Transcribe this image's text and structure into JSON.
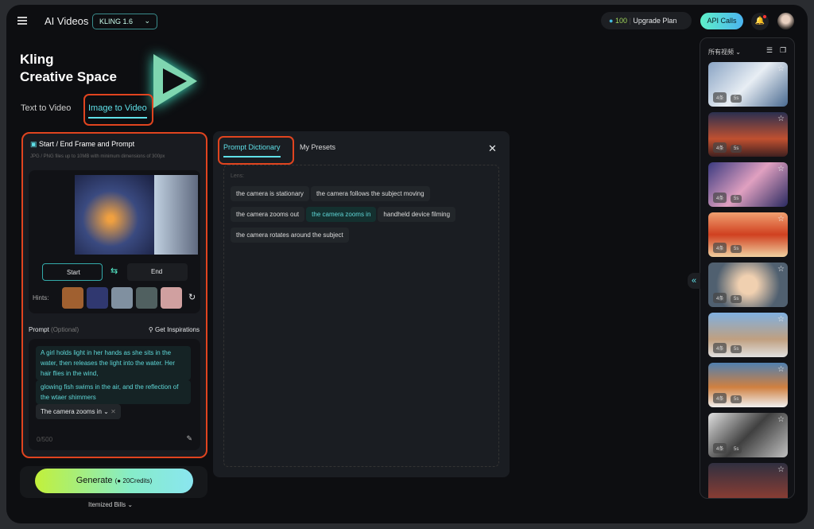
{
  "header": {
    "title": "AI Videos",
    "model": "KLING 1.6",
    "credits": "100",
    "upgrade": "Upgrade Plan",
    "api": "API Calls"
  },
  "hero": {
    "line1": "Kling",
    "line2": "Creative Space"
  },
  "tabs": [
    {
      "label": "Text to Video"
    },
    {
      "label": "Image to Video",
      "active": true
    }
  ],
  "frame": {
    "title": "Start / End Frame and Prompt",
    "hint": "JPG / PNG files up to 10MB with minimum dimensions of 300px",
    "start": "Start",
    "end": "End",
    "hints_label": "Hints:"
  },
  "prompt": {
    "label": "Prompt",
    "optional": "(Optional)",
    "inspire": "Get Inspirations",
    "seg1": "A girl holds light in her hands as she sits in the water, then releases the light into the water. Her hair flies in the wind,",
    "seg2": "glowing fish swims in the air, and the reflection of the wtaer shimmers",
    "camera": "The camera zooms in",
    "count": "0/500"
  },
  "generate": {
    "label": "Generate",
    "credits": "20Credits",
    "bills": "Itemized Bills"
  },
  "dictionary": {
    "tabs": [
      "Prompt Dictionary",
      "My Presets"
    ],
    "section": "Lens:",
    "chips": [
      "the camera is stationary",
      "the camera follows the subject moving",
      "the camera zooms out",
      "the camera zooms in",
      "handheld device filming",
      "the camera rotates around the subject"
    ],
    "selected": "the camera zooms in"
  },
  "sidebar": {
    "filter": "所有视频",
    "items": [
      {
        "count": "4条",
        "dur": "5s",
        "bg": "linear-gradient(135deg,#8aa4c4,#e8eef4 50%,#4a6a90)"
      },
      {
        "count": "4条",
        "dur": "5s",
        "bg": "linear-gradient(180deg,#2a3050,#c05030 60%,#402020)"
      },
      {
        "count": "4条",
        "dur": "5s",
        "bg": "linear-gradient(135deg,#3a3a80,#e0a0c0 50%,#2a2a60)"
      },
      {
        "count": "4条",
        "dur": "5s",
        "bg": "linear-gradient(180deg,#f0a070,#d04020 50%,#f0d0a0)"
      },
      {
        "count": "4条",
        "dur": "5s",
        "bg": "radial-gradient(circle,#f0d0b0 20%,#506070 70%)"
      },
      {
        "count": "4条",
        "dur": "5s",
        "bg": "linear-gradient(180deg,#80b0e0,#c0a080 60%,#e0e0e0)"
      },
      {
        "count": "4条",
        "dur": "5s",
        "bg": "linear-gradient(180deg,#5080b0,#d08040 55%,#f0f0f0)"
      },
      {
        "count": "4条",
        "dur": "5s",
        "bg": "linear-gradient(135deg,#e0e0e0,#404040 50%,#c0c0c0)"
      },
      {
        "count": "",
        "dur": "",
        "bg": "linear-gradient(180deg,#303040,#a04030)"
      }
    ]
  }
}
